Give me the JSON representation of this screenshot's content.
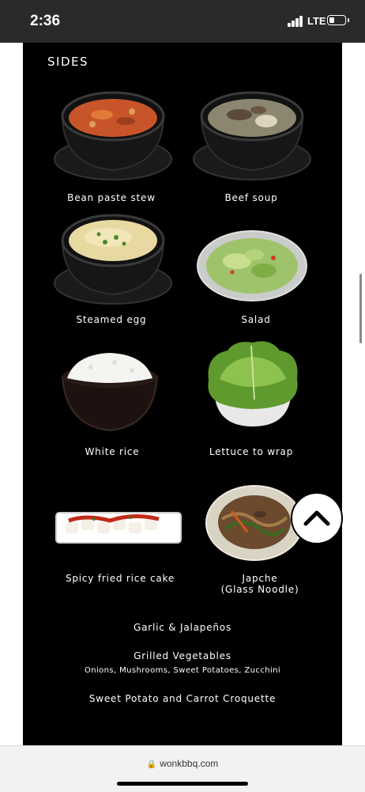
{
  "status_bar": {
    "time": "2:36",
    "network": "LTE",
    "battery_level": 0.35
  },
  "section": {
    "title": "SIDES"
  },
  "items": [
    {
      "label": "Bean paste stew"
    },
    {
      "label": "Beef soup"
    },
    {
      "label": "Steamed egg"
    },
    {
      "label": "Salad"
    },
    {
      "label": "White rice"
    },
    {
      "label": "Lettuce to wrap"
    },
    {
      "label": "Spicy fried rice cake"
    },
    {
      "label": "Japche",
      "label_line2": "(Glass Noodle)"
    }
  ],
  "extras": {
    "garlic": "Garlic & Jalapeños",
    "grilled_title": "Grilled Vegetables",
    "grilled_detail": "Onions, Mushrooms, Sweet Potatoes, Zucchini",
    "croquette": "Sweet Potato and Carrot Croquette"
  },
  "browser": {
    "url": "wonkbbq.com"
  },
  "colors": {
    "panel": "#000000",
    "text": "#ffffff",
    "status_bar": "#2a2a2a"
  }
}
